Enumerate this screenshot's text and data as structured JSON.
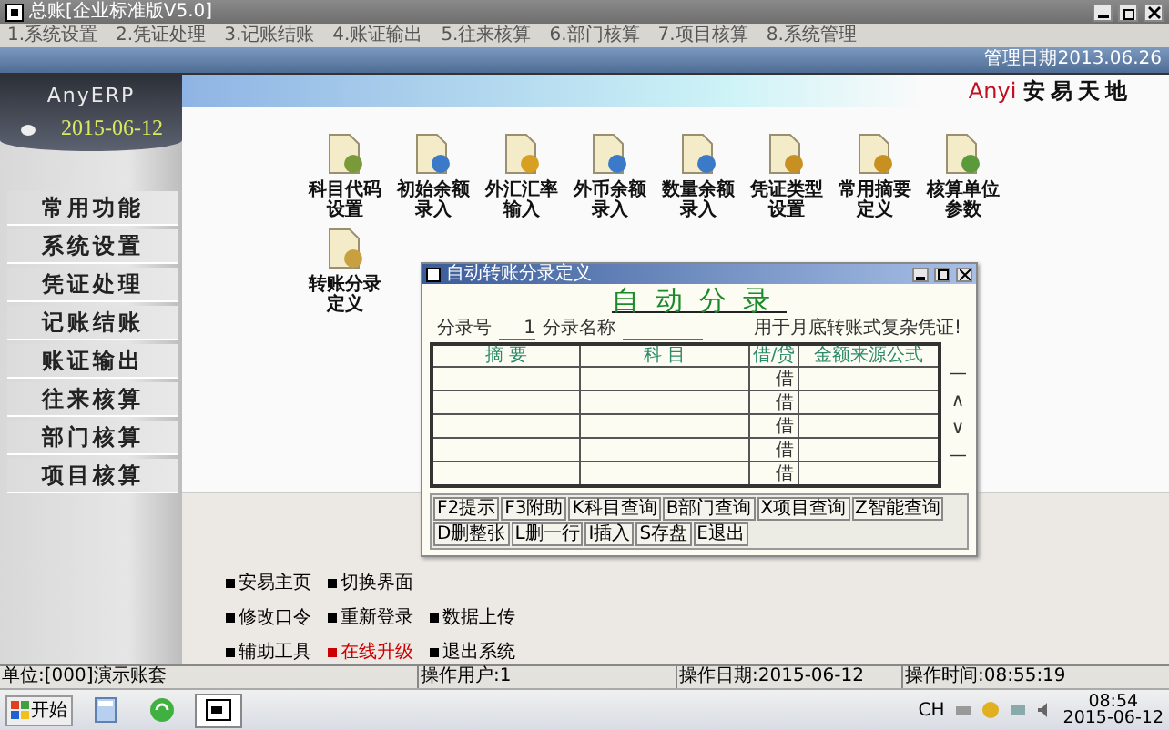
{
  "window": {
    "title": "总账[企业标准版V5.0]"
  },
  "menu": [
    "1.系统设置",
    "2.凭证处理",
    "3.记账结账",
    "4.账证输出",
    "5.往来核算",
    "6.部门核算",
    "7.项目核算",
    "8.系统管理"
  ],
  "header": {
    "date_info": "管理日期2013.06.26",
    "brand": "AnyERP",
    "date": "2015-06-12",
    "logo_latin": "Anyi",
    "logo_cn": "安易天地"
  },
  "nav": [
    "常用功能",
    "系统设置",
    "凭证处理",
    "记账结账",
    "账证输出",
    "往来核算",
    "部门核算",
    "项目核算"
  ],
  "shortcuts": [
    "科目代码设置",
    "初始余额录入",
    "外汇汇率输入",
    "外币余额录入",
    "数量余额录入",
    "凭证类型设置",
    "常用摘要定义",
    "核算单位参数",
    "转账分录定义"
  ],
  "links": [
    [
      {
        "label": "安易主页",
        "color": "#000000"
      },
      {
        "label": "切换界面",
        "color": "#000000"
      }
    ],
    [
      {
        "label": "修改口令",
        "color": "#000000"
      },
      {
        "label": "重新登录",
        "color": "#000000"
      },
      {
        "label": "数据上传",
        "color": "#000000"
      }
    ],
    [
      {
        "label": "辅助工具",
        "color": "#000000"
      },
      {
        "label": "在线升级",
        "color": "#cc0000"
      },
      {
        "label": "退出系统",
        "color": "#000000"
      }
    ]
  ],
  "dialog": {
    "title": "自动转账分录定义",
    "heading": "自动分录",
    "entry_no_label": "分录号",
    "entry_no": "1",
    "entry_name_label": "分录名称",
    "note": "用于月底转账式复杂凭证!",
    "columns": [
      "摘 要",
      "科 目",
      "借/贷",
      "金额来源公式"
    ],
    "rows": [
      {
        "direction": "借"
      },
      {
        "direction": "借"
      },
      {
        "direction": "借"
      },
      {
        "direction": "借"
      },
      {
        "direction": "借"
      }
    ],
    "side_buttons": [
      "—",
      "∧",
      "∨",
      "—"
    ],
    "buttons": [
      "F2提示",
      "F3附助",
      "K科目查询",
      "B部门查询",
      "X项目查询",
      "Z智能查询",
      "D删整张",
      "L删一行",
      "I插入",
      "S存盘",
      "E退出"
    ]
  },
  "status_bar": [
    "单位:[000]演示账套",
    "操作用户:1",
    "操作日期:2015-06-12",
    "操作时间:08:55:19"
  ],
  "taskbar": {
    "start": "开始",
    "language": "CH",
    "time": "08:54",
    "date": "2015-06-12"
  }
}
